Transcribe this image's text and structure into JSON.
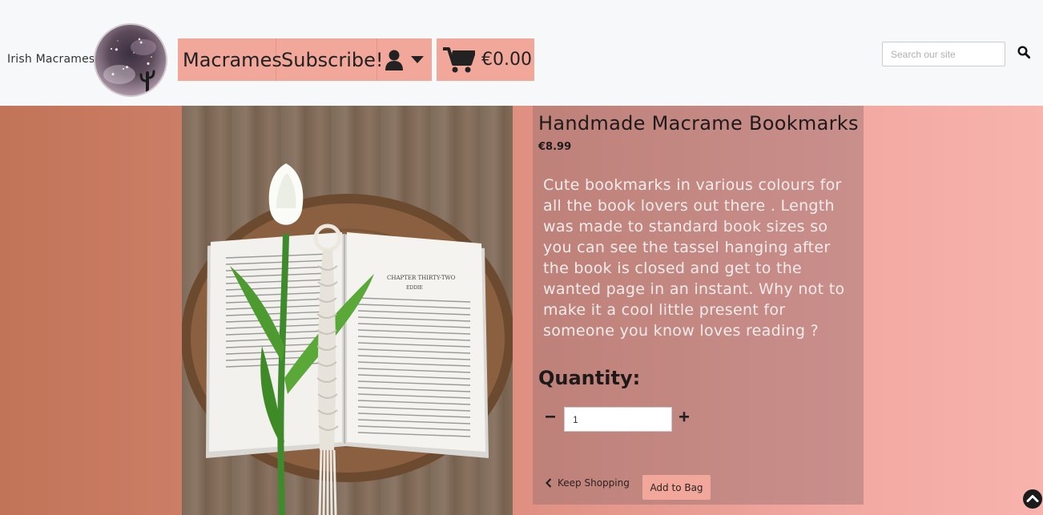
{
  "header": {
    "brand": "Irish Macrames",
    "nav": {
      "macrames": "Macrames",
      "subscribe": "Subscribe!"
    },
    "cart_total": "€0.00",
    "search_placeholder": "Search our site"
  },
  "product": {
    "title": "Handmade Macrame Bookmarks",
    "price": "€8.99",
    "description": "Cute bookmarks in various colours for all the book lovers out there . Length was made to standard book sizes so you can see the tassel hanging after the book is closed and get to the wanted page in an instant. Why not to make it a cool little present for someone you know loves reading ?",
    "quantity_label": "Quantity:",
    "quantity_value": "1"
  },
  "actions": {
    "keep_shopping": "Keep Shopping",
    "add_to_bag": "Add to Bag"
  },
  "book": {
    "chapter_heading": "CHAPTER THIRTY-TWO",
    "chapter_sub": "EDDIE"
  },
  "icons": {
    "user": "user-icon",
    "caret": "caret-down-icon",
    "cart": "shopping-cart-icon",
    "search": "search-icon",
    "minus": "minus-icon",
    "plus": "plus-icon",
    "back": "chevron-left-icon",
    "top": "chevron-circle-up-icon"
  },
  "colors": {
    "accent": "#f1a79a",
    "header_bg": "#f7f8fa"
  }
}
